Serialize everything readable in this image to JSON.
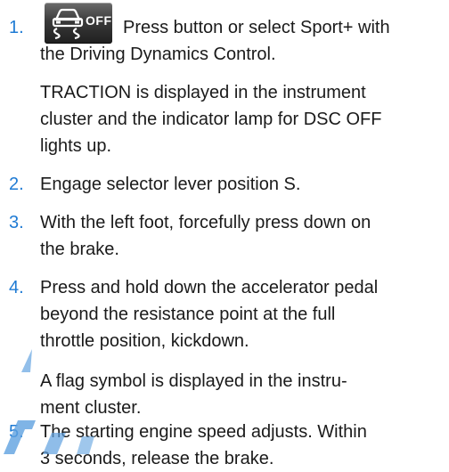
{
  "steps": [
    {
      "number": "1.",
      "icon": {
        "name": "dsc-off-icon",
        "label": "OFF"
      },
      "lines": [
        "Press button or select Sport+ with",
        "the Driving Dynamics Control."
      ],
      "note_lines": [
        "TRACTION is displayed in the instrument",
        "cluster and the indicator lamp for DSC OFF",
        "lights up."
      ]
    },
    {
      "number": "2.",
      "lines": [
        "Engage selector lever position S."
      ]
    },
    {
      "number": "3.",
      "lines": [
        "With the left foot, forcefully press down on",
        "the brake."
      ]
    },
    {
      "number": "4.",
      "lines": [
        "Press and hold down the accelerator pedal",
        "beyond the resistance point at the full",
        "throttle position, kickdown."
      ],
      "note_lines": [
        "A flag symbol is displayed in the instru-",
        "ment cluster."
      ]
    },
    {
      "number": "5.",
      "lines": [
        "The starting engine speed adjusts. Within",
        "3 seconds, release the brake."
      ]
    }
  ],
  "colors": {
    "number": "#1f7bd4",
    "text": "#1a1a1a",
    "watermark": "#2a83d6"
  }
}
